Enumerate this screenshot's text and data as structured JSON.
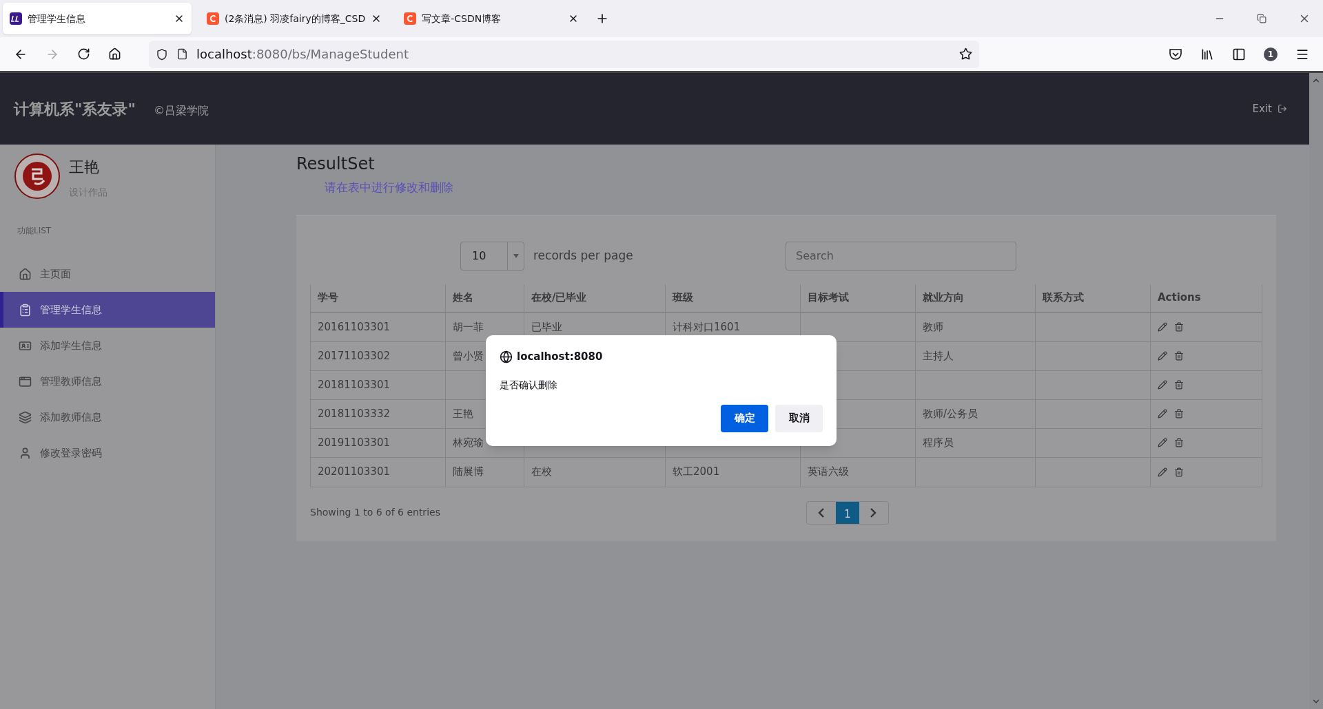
{
  "browser": {
    "tabs": [
      {
        "title": "管理学生信息",
        "selected": true
      },
      {
        "title": "(2条消息) 羽凌fairy的博客_CSD",
        "selected": false
      },
      {
        "title": "写文章-CSDN博客",
        "selected": false
      }
    ],
    "url": {
      "host": "localhost",
      "path": ":8080/bs/ManageStudent"
    },
    "account_badge": "1"
  },
  "header": {
    "title": "计算机系\"系友录\"",
    "subtitle": "©吕梁学院",
    "exit": "Exit"
  },
  "sidebar": {
    "user": {
      "name": "王艳",
      "role": "设计作品"
    },
    "section_label": "功能LIST",
    "items": [
      {
        "label": "主页面",
        "selected": false
      },
      {
        "label": "管理学生信息",
        "selected": true
      },
      {
        "label": "添加学生信息",
        "selected": false
      },
      {
        "label": "管理教师信息",
        "selected": false
      },
      {
        "label": "添加教师信息",
        "selected": false
      },
      {
        "label": "修改登录密码",
        "selected": false
      }
    ]
  },
  "main": {
    "title": "ResultSet",
    "hint": "请在表中进行修改和删除",
    "page_size": "10",
    "page_size_label": "records per page",
    "search": {
      "placeholder": "Search"
    },
    "table": {
      "columns": [
        {
          "label": "学号",
          "kind": "text"
        },
        {
          "label": "姓名",
          "kind": "text"
        },
        {
          "label": "在校/已毕业",
          "kind": "text"
        },
        {
          "label": "班级",
          "kind": "text"
        },
        {
          "label": "目标考试",
          "kind": "text"
        },
        {
          "label": "就业方向",
          "kind": "text"
        },
        {
          "label": "联系方式",
          "kind": "text"
        },
        {
          "label": "Actions",
          "kind": "actions"
        }
      ],
      "rows": [
        [
          "20161103301",
          "胡一菲",
          "已毕业",
          "计科对口1601",
          null,
          "教师",
          null
        ],
        [
          "20171103302",
          "曾小贤",
          null,
          null,
          null,
          "主持人",
          null
        ],
        [
          "20181103301",
          null,
          null,
          null,
          null,
          null,
          null
        ],
        [
          "20181103332",
          "王艳",
          null,
          null,
          null,
          "教师/公务员",
          null
        ],
        [
          "20191103301",
          "林宛瑜",
          null,
          null,
          null,
          "程序员",
          null
        ],
        [
          "20201103301",
          "陆展博",
          "在校",
          "软工2001",
          "英语六级",
          null,
          null
        ]
      ]
    },
    "footer": "Showing 1 to 6 of 6 entries",
    "pages": [
      {
        "label": "1",
        "selected": true
      }
    ]
  },
  "dialog": {
    "origin": "localhost:8080",
    "message": "是否确认删除",
    "buttons": [
      {
        "label": "确定",
        "kind": "primary"
      },
      {
        "label": "取消",
        "kind": "secondary"
      }
    ]
  }
}
